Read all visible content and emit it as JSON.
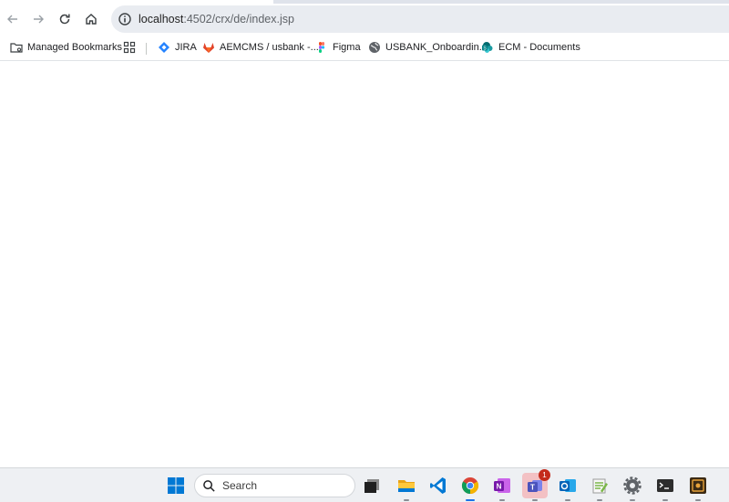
{
  "browser": {
    "address_bar": {
      "host": "localhost",
      "path": ":4502/crx/de/index.jsp"
    }
  },
  "bookmarks": {
    "managed_label": "Managed Bookmarks",
    "items": [
      {
        "label": "JIRA",
        "icon": "jira-icon"
      },
      {
        "label": "AEMCMS / usbank -...",
        "icon": "gitlab-icon"
      },
      {
        "label": "Figma",
        "icon": "figma-icon"
      },
      {
        "label": "USBANK_Onboardin...",
        "icon": "globe-icon"
      },
      {
        "label": "ECM - Documents",
        "icon": "sharepoint-icon"
      }
    ]
  },
  "taskbar": {
    "search_label": "Search",
    "teams_badge": "1",
    "apps": [
      "windows-start-icon",
      "task-view-icon",
      "file-explorer-icon",
      "vscode-icon",
      "chrome-icon",
      "onenote-icon",
      "teams-icon",
      "outlook-icon",
      "notepad-plus-icon",
      "settings-icon",
      "terminal-icon",
      "app-icon"
    ]
  },
  "colors": {
    "accent": "#1a73e8",
    "omnibox_bg": "#e9ecf1",
    "taskbar_bg": "#eef0f3"
  }
}
